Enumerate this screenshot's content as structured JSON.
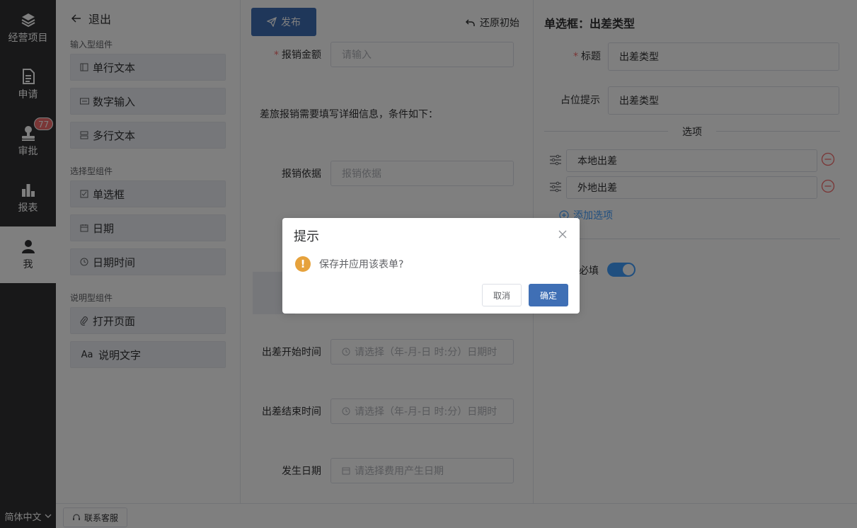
{
  "nav": {
    "items": [
      {
        "label": "经营项目",
        "icon": "layers-icon"
      },
      {
        "label": "申请",
        "icon": "document-icon"
      },
      {
        "label": "审批",
        "icon": "stamp-icon",
        "badge": "77"
      },
      {
        "label": "报表",
        "icon": "bar-chart-icon"
      },
      {
        "label": "我",
        "icon": "user-icon"
      }
    ],
    "language": "简体中文"
  },
  "footer": {
    "service_label": "联系客服"
  },
  "components": {
    "exit_label": "退出",
    "groups": [
      {
        "title": "输入型组件",
        "items": [
          "单行文本",
          "数字输入",
          "多行文本"
        ]
      },
      {
        "title": "选择型组件",
        "items": [
          "单选框",
          "日期",
          "日期时间"
        ]
      },
      {
        "title": "说明型组件",
        "items": [
          "打开页面",
          "说明文字"
        ]
      }
    ],
    "text_icon_glyph": "Aa"
  },
  "canvas": {
    "publish_label": "发布",
    "restore_label": "还原初始",
    "fields": {
      "amount": {
        "label": "报销金额",
        "placeholder": "请输入"
      },
      "description": "差旅报销需要填写详细信息，条件如下：",
      "basis": {
        "label": "报销依据",
        "placeholder": "报销依据"
      },
      "start_time": {
        "label": "出差开始时间",
        "placeholder": "请选择（年-月-日 时:分）日期时"
      },
      "end_time": {
        "label": "出差结束时间",
        "placeholder": "请选择（年-月-日 时:分）日期时"
      },
      "occur_date": {
        "label": "发生日期",
        "placeholder": "请选择费用产生日期"
      }
    },
    "required_mark": "*"
  },
  "properties": {
    "title": "单选框：出差类型",
    "title_field": {
      "label": "标题",
      "value": "出差类型"
    },
    "placeholder_field": {
      "label": "占位提示",
      "value": "出差类型"
    },
    "options_divider": "选项",
    "options": [
      "本地出差",
      "外地出差"
    ],
    "add_option_label": "添加选项",
    "required_label": "必填",
    "required_on": true
  },
  "dialog": {
    "title": "提示",
    "message": "保存并应用该表单?",
    "warn_glyph": "!",
    "cancel_label": "取消",
    "ok_label": "确定"
  },
  "colors": {
    "primary": "#409eff",
    "nav_bg": "#303133",
    "danger": "#f56c6c",
    "warning": "#e6a23c"
  }
}
